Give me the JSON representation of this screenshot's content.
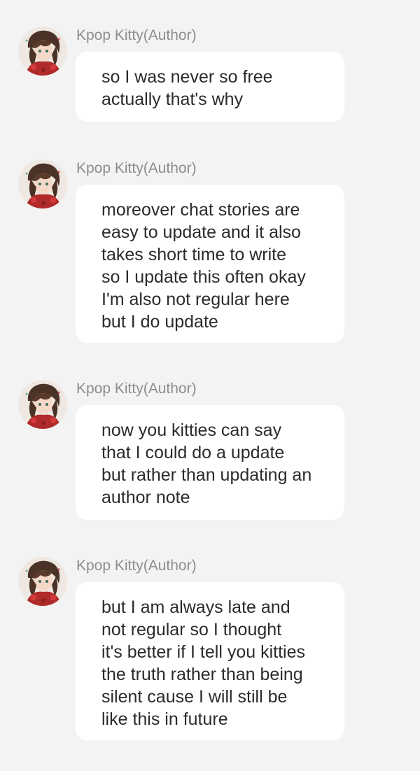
{
  "messages": [
    {
      "author": "Kpop Kitty(Author)",
      "avatar_icon": "anime-girl-avatar-icon",
      "lines": [
        "so I was never so free",
        "actually that's why"
      ]
    },
    {
      "author": "Kpop Kitty(Author)",
      "avatar_icon": "anime-girl-avatar-icon",
      "lines": [
        "moreover chat stories are",
        "easy to update and it also",
        "takes short time to write",
        "so I update this often okay",
        "I'm also not regular here",
        "but I do update"
      ]
    },
    {
      "author": "Kpop Kitty(Author)",
      "avatar_icon": "anime-girl-avatar-icon",
      "lines": [
        "now you kitties can say",
        "that I could do a update",
        "but rather than updating an",
        "author note"
      ]
    },
    {
      "author": "Kpop Kitty(Author)",
      "avatar_icon": "anime-girl-avatar-icon",
      "lines": [
        "but I am always late and",
        "not regular so I thought",
        "it's better if I tell you kitties",
        "the truth rather than being",
        "silent cause I will still be",
        "like this in future"
      ]
    }
  ],
  "colors": {
    "background": "#f3f3f3",
    "bubble": "#ffffff",
    "author_text": "#8d8d8d",
    "message_text": "#2b2b2b"
  }
}
